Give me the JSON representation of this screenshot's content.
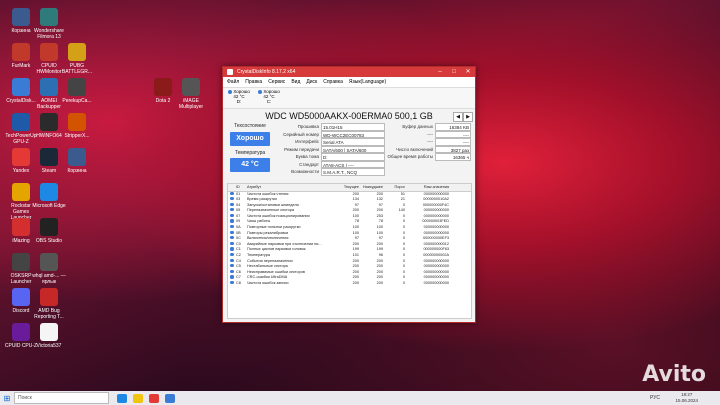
{
  "desktop": {
    "icons": [
      {
        "label": "Корзина",
        "color": "#3b5b8f"
      },
      {
        "label": "Wondershare Filmora 13",
        "color": "#2f7a7a"
      },
      {
        "label": "FurMark",
        "color": "#c0392b"
      },
      {
        "label": "CPUID HWMonitor",
        "color": "#c0392b"
      },
      {
        "label": "PUBG BATTLEGR...",
        "color": "#d4a017"
      },
      {
        "label": "CrystalDisk...",
        "color": "#3a7bd5"
      },
      {
        "label": "AOMEI Backupper",
        "color": "#2c6fb3"
      },
      {
        "label": "PerekupCa...",
        "color": "#444"
      },
      {
        "label": "Dota 2",
        "color": "#8b1a1a"
      },
      {
        "label": "iMAGE Multiplayer",
        "color": "#555"
      },
      {
        "label": "TechPowerUp GPU-Z",
        "color": "#1e5aa8"
      },
      {
        "label": "HWiNFO64",
        "color": "#2b2b2b"
      },
      {
        "label": "StripperX...",
        "color": "#d35400"
      },
      {
        "label": "Yandex",
        "color": "#e53935"
      },
      {
        "label": "Steam",
        "color": "#1b2838"
      },
      {
        "label": "Корзина",
        "color": "#3b5b8f"
      },
      {
        "label": "Rockstar Games Launcher",
        "color": "#e5a500"
      },
      {
        "label": "Microsoft Edge",
        "color": "#1e88e5"
      },
      {
        "label": "iMazing",
        "color": "#d32f2f"
      },
      {
        "label": "OBS Studio",
        "color": "#222"
      },
      {
        "label": "OSKSRP Launcher",
        "color": "#444"
      },
      {
        "label": "whql amd-... — ярлык",
        "color": "#555"
      },
      {
        "label": "Discord",
        "color": "#5865f2"
      },
      {
        "label": "AMD Bug Reporting T...",
        "color": "#c62828"
      },
      {
        "label": "CPUID CPU-Z",
        "color": "#6a1b9a"
      },
      {
        "label": "Victoria537",
        "color": "#f5f5f5"
      }
    ]
  },
  "window": {
    "title": "CrystalDiskInfo 8.17.2 x64",
    "menu": [
      "Файл",
      "Правка",
      "Сервис",
      "Вид",
      "Диск",
      "Справка",
      "Язык(Language)"
    ],
    "drive_tab": {
      "status": "Хорошо",
      "temp": "42 °C",
      "letter": "D:"
    },
    "drive_tab2": {
      "status": "Хорошо",
      "temp": "42 °C",
      "letter": "C:"
    },
    "model": "WDC WD5000AAKX-00ERMA0 500,1 GB",
    "health_label": "Техсостояние",
    "health_value": "Хорошо",
    "temp_label": "Температура",
    "temp_value": "42 °C",
    "fields": [
      {
        "k": "Прошивка",
        "v": "15.01H15"
      },
      {
        "k": "Серийный номер",
        "v": "WD-WCC2EC00783"
      },
      {
        "k": "Интерфейс",
        "v": "Serial ATA"
      },
      {
        "k": "Режим передачи",
        "v": "SATA/600 | SATA/600"
      },
      {
        "k": "Буква тома",
        "v": "D:"
      },
      {
        "k": "Стандарт",
        "v": "ATA8-ACS | ----"
      },
      {
        "k": "Возможности",
        "v": "S.M.A.R.T., NCQ"
      }
    ],
    "rfields": [
      {
        "k": "Буфер данных",
        "v": "16384 KB"
      },
      {
        "k": "----",
        "v": "----"
      },
      {
        "k": "----",
        "v": "----"
      },
      {
        "k": "Число включений",
        "v": "3827 раз"
      },
      {
        "k": "Общее время работы",
        "v": "16365 ч"
      }
    ],
    "table": {
      "headers": [
        "ID",
        "Атрибут",
        "Текущее",
        "Наихудшее",
        "Порог",
        "Raw-значения"
      ],
      "rows": [
        [
          "01",
          "Частота ошибок чтения",
          "200",
          "200",
          "51",
          "000000000000"
        ],
        [
          "03",
          "Время раскрутки",
          "134",
          "132",
          "21",
          "0000000010A2"
        ],
        [
          "04",
          "Запуски/остановки шпинделя",
          "97",
          "97",
          "0",
          "000000000F4C"
        ],
        [
          "05",
          "Переназначенные сектора",
          "200",
          "200",
          "140",
          "000000000000"
        ],
        [
          "07",
          "Частота ошибок позиционирования",
          "100",
          "253",
          "0",
          "000000000000"
        ],
        [
          "09",
          "Часы работы",
          "78",
          "78",
          "0",
          "000000003FED"
        ],
        [
          "0A",
          "Повторные попытки раскрутки",
          "100",
          "100",
          "0",
          "000000000000"
        ],
        [
          "0B",
          "Повторы рекалибровки",
          "100",
          "100",
          "0",
          "000000000000"
        ],
        [
          "0C",
          "Включения/отключения",
          "97",
          "97",
          "0",
          "000000000EF3"
        ],
        [
          "C0",
          "Аварийные парковки при отключении пи...",
          "200",
          "200",
          "0",
          "000000000012"
        ],
        [
          "C1",
          "Полных циклов парковки головок",
          "199",
          "199",
          "0",
          "000000000F63"
        ],
        [
          "C2",
          "Температура",
          "101",
          "96",
          "0",
          "00000000002A"
        ],
        [
          "C4",
          "События переназначения",
          "200",
          "200",
          "0",
          "000000000000"
        ],
        [
          "C5",
          "Нестабильные сектора",
          "200",
          "200",
          "0",
          "000000000000"
        ],
        [
          "C6",
          "Неисправимые ошибки секторов",
          "200",
          "200",
          "0",
          "000000000000"
        ],
        [
          "C7",
          "CRC-ошибки UltraDMA",
          "200",
          "200",
          "0",
          "000000000000"
        ],
        [
          "C8",
          "Частота ошибок записи",
          "200",
          "200",
          "0",
          "000000000000"
        ]
      ]
    }
  },
  "taskbar": {
    "search_placeholder": "Поиск",
    "language": "РУС",
    "time": "18:27",
    "date": "15.06.2024"
  },
  "watermark": "Avito"
}
